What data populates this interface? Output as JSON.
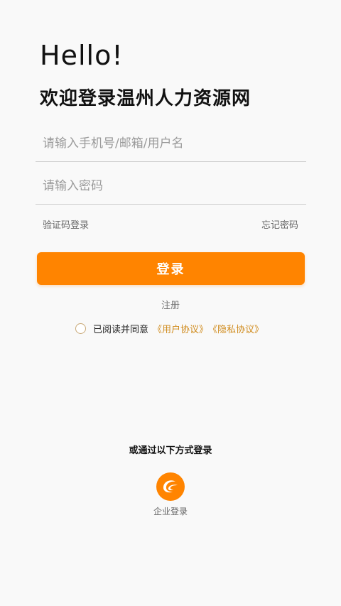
{
  "header": {
    "greeting": "Hello!",
    "welcome": "欢迎登录温州人力资源网"
  },
  "form": {
    "account_placeholder": "请输入手机号/邮箱/用户名",
    "account_value": "",
    "password_placeholder": "请输入密码",
    "password_value": "",
    "sms_login_label": "验证码登录",
    "forgot_password_label": "忘记密码",
    "login_button_label": "登录",
    "register_label": "注册"
  },
  "agreement": {
    "checked": false,
    "text": "已阅读并同意",
    "user_agreement": "《用户协议》",
    "privacy_agreement": "《隐私协议》"
  },
  "other_login": {
    "title": "或通过以下方式登录",
    "enterprise_label": "企业登录",
    "enterprise_icon": "enterprise-logo-icon"
  },
  "colors": {
    "accent": "#ff8400",
    "link": "#d08b1c",
    "background": "#f9f9f9"
  }
}
